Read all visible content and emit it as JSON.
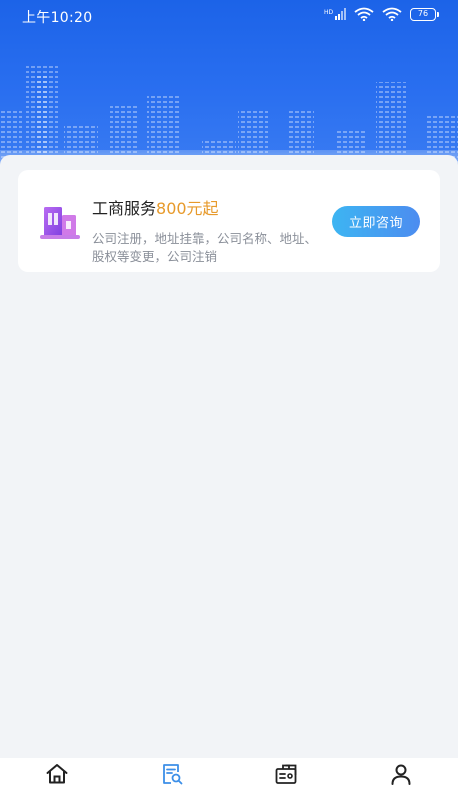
{
  "status_bar": {
    "time": "上午10:20",
    "battery": "76",
    "icons": [
      "hd-signal-icon",
      "wifi-icon",
      "wifi-icon",
      "battery-icon"
    ]
  },
  "service_card": {
    "title": "工商服务",
    "price": "800元起",
    "description": "公司注册，地址挂靠，公司名称、地址、股权等变更，公司注销",
    "button_label": "立即咨询",
    "icon": "building-icon"
  },
  "tab_bar": {
    "tabs": [
      {
        "icon": "home-icon",
        "active": false
      },
      {
        "icon": "document-search-icon",
        "active": true
      },
      {
        "icon": "briefcase-icon",
        "active": false
      },
      {
        "icon": "user-icon",
        "active": false
      }
    ]
  },
  "colors": {
    "hero_blue": "#1c63e8",
    "price_orange": "#e79a2b",
    "button_start": "#3db5f2",
    "button_end": "#4c8cf0",
    "active_tab": "#3c8fe8",
    "background": "#f2f4f7"
  }
}
